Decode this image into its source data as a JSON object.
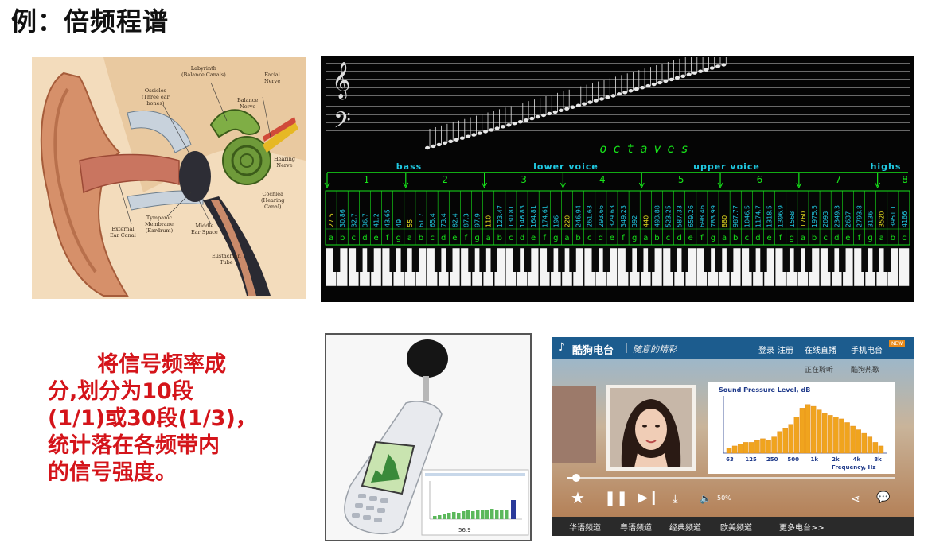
{
  "title": "例：倍频程谱",
  "ear": {
    "labels": [
      {
        "text": "Labyrinth\n(Balance Canals)"
      },
      {
        "text": "Facial\nNerve"
      },
      {
        "text": "Ossicles\n(Three ear\nbones)"
      },
      {
        "text": "Balance\nNerve"
      },
      {
        "text": "Hearing\nNerve"
      },
      {
        "text": "Cochlea\n(Hearing\nCanal)"
      },
      {
        "text": "Tympanic\nMembrane\n(Eardrum)"
      },
      {
        "text": "Middle\nEar Space"
      },
      {
        "text": "External\nEar Canal"
      },
      {
        "text": "Eustachian\nTube"
      }
    ]
  },
  "octaves": {
    "title": "octaves",
    "ranges": [
      "bass",
      "lower voice",
      "upper voice",
      "highs"
    ],
    "numbers": [
      "1",
      "2",
      "3",
      "4",
      "5",
      "6",
      "7",
      "8"
    ],
    "freqs": [
      "27.5",
      "30.86",
      "32.7",
      "36.7",
      "41.2",
      "43.65",
      "49",
      "55",
      "61.7",
      "65.4",
      "73.4",
      "82.4",
      "87.3",
      "97.9",
      "110",
      "123.47",
      "130.81",
      "146.83",
      "164.81",
      "174.61",
      "196",
      "220",
      "246.94",
      "261.63",
      "293.66",
      "329.63",
      "349.23",
      "392",
      "440",
      "493.88",
      "523.25",
      "587.33",
      "659.26",
      "698.46",
      "783.99",
      "880",
      "987.77",
      "1046.5",
      "1174.7",
      "1318.5",
      "1396.9",
      "1568",
      "1760",
      "1975.5",
      "2093",
      "2349.3",
      "2637",
      "2793.8",
      "3136",
      "3520",
      "3951.1",
      "4186"
    ],
    "note_letters": [
      "a",
      "b",
      "c",
      "d",
      "e",
      "f",
      "g"
    ],
    "colors": {
      "green": "#17e31a",
      "cyan": "#20c8e0",
      "yellow": "#e8e020"
    }
  },
  "description": [
    "将信号频率成",
    "分,划分为10段",
    "(1/1)或30段(1/3)，",
    "统计落在各频带内",
    "的信号强度。"
  ],
  "meter": {
    "display": "56.9"
  },
  "player": {
    "brand": "酷狗电台",
    "slogan": "随意的精彩",
    "header_links": [
      "登录",
      "注册",
      "在线直播",
      "手机电台"
    ],
    "badge": "NEW",
    "now_playing": "正在聆听",
    "hot": "酷狗热歌",
    "chart_title": "Sound Pressure Level, dB",
    "chart_xlabel": "Frequency, Hz",
    "volume": "50%",
    "channels": [
      "华语频道",
      "粤语频道",
      "经典频道",
      "欧美频道",
      "更多电台>>"
    ]
  },
  "chart_data": {
    "type": "bar",
    "title": "Sound Pressure Level, dB",
    "xlabel": "Frequency, Hz",
    "ylabel": "",
    "tick_labels": [
      "63",
      "125",
      "250",
      "500",
      "1k",
      "2k",
      "4k",
      "8k"
    ],
    "values": [
      3,
      4,
      5,
      6,
      6,
      7,
      8,
      7,
      9,
      12,
      14,
      16,
      20,
      25,
      27,
      26,
      24,
      22,
      21,
      20,
      19,
      17,
      15,
      13,
      11,
      9,
      6,
      4
    ]
  }
}
